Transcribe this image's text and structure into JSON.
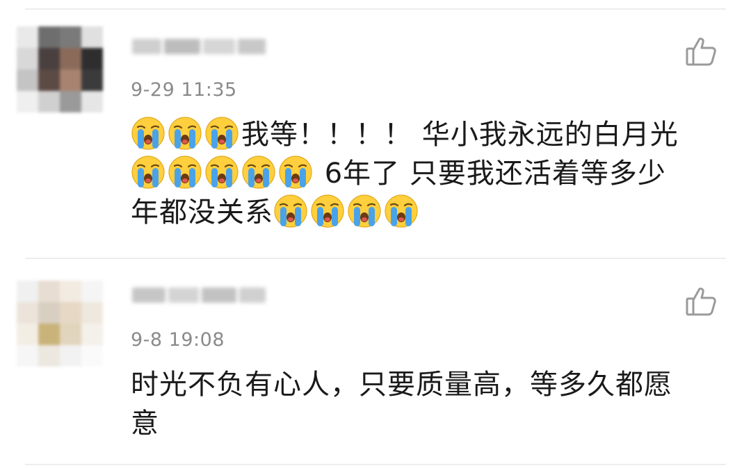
{
  "comments": [
    {
      "username": "",
      "timestamp": "9-29 11:35",
      "line1_emojis": 3,
      "line1_text": "我等！！！！ 华小我永远的白月光",
      "line2_emojis": 5,
      "line2_text": " 6年了 只要我还活着等多少",
      "line3_text": "年都没关系",
      "line3_emojis": 4,
      "emoji_name": "crying-face-emoji",
      "like_icon": "thumbs-up-icon"
    },
    {
      "username": "",
      "timestamp": "9-8 19:08",
      "line1_text": "时光不负有心人，只要质量高，等多久都愿",
      "line2_text": "意",
      "like_icon": "thumbs-up-icon"
    }
  ],
  "colors": {
    "timestamp": "#8a8a8a",
    "body_text": "#1a1a1a",
    "divider": "#ededed",
    "like_icon": "#9a9a9a",
    "emoji_face": "#ffcf3d",
    "emoji_tears": "#4aa3e8"
  }
}
